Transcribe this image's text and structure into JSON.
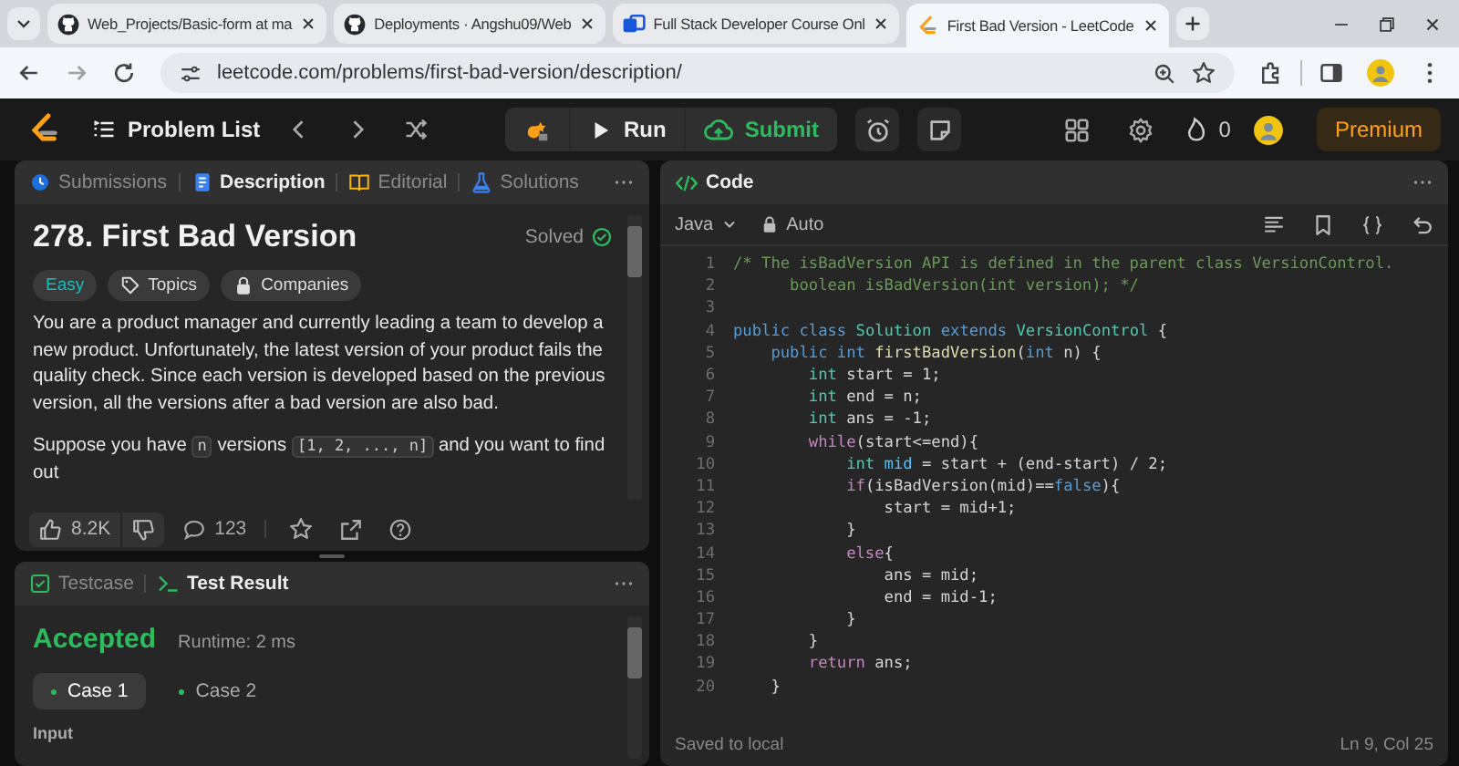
{
  "browser": {
    "tabs": [
      {
        "title": "Web_Projects/Basic-form at ma",
        "kind": "github",
        "selected": false
      },
      {
        "title": "Deployments · Angshu09/Web",
        "kind": "github",
        "selected": false
      },
      {
        "title": "Full Stack Developer Course Onl",
        "kind": "course",
        "selected": false
      },
      {
        "title": "First Bad Version - LeetCode",
        "kind": "leetcode",
        "selected": true
      }
    ],
    "url": "leetcode.com/problems/first-bad-version/description/"
  },
  "nav": {
    "problem_list": "Problem List",
    "run": "Run",
    "submit": "Submit",
    "streak": "0",
    "premium": "Premium"
  },
  "description_panel": {
    "tabs": [
      {
        "label": "Submissions",
        "selected": false
      },
      {
        "label": "Description",
        "selected": true
      },
      {
        "label": "Editorial",
        "selected": false
      },
      {
        "label": "Solutions",
        "selected": false
      }
    ],
    "title": "278. First Bad Version",
    "status": "Solved",
    "difficulty": "Easy",
    "tags": [
      "Topics",
      "Companies"
    ],
    "paragraphs": [
      "You are a product manager and currently leading a team to develop a new product. Unfortunately, the latest version of your product fails the quality check. Since each version is developed based on the previous version, all the versions after a bad version are also bad."
    ],
    "suppose": {
      "before": "Suppose you have",
      "code1": "n",
      "middle": "versions",
      "code2": "[1, 2, ..., n]",
      "after": "and you want to find out"
    },
    "likes": "8.2K",
    "comments": "123"
  },
  "result_panel": {
    "tabs": [
      {
        "label": "Testcase",
        "selected": false
      },
      {
        "label": "Test Result",
        "selected": true
      }
    ],
    "verdict": "Accepted",
    "runtime": "Runtime: 2 ms",
    "cases": [
      {
        "label": "Case 1",
        "selected": true
      },
      {
        "label": "Case 2",
        "selected": false
      }
    ],
    "input_label": "Input"
  },
  "code_panel": {
    "title": "Code",
    "language": "Java",
    "mode": "Auto",
    "footer_left": "Saved to local",
    "footer_right": "Ln 9, Col 25",
    "lines": [
      {
        "n": "1",
        "tokens": [
          {
            "text": "/* The isBadVersion API is defined in the parent class VersionControl.",
            "kind": "comment"
          }
        ]
      },
      {
        "n": "2",
        "tokens": [
          {
            "text": "      boolean isBadVersion(int version); */",
            "kind": "comment"
          }
        ]
      },
      {
        "n": "3"
      },
      {
        "n": "4",
        "tokens": [
          {
            "text": "public class ",
            "kind": "kw"
          },
          {
            "text": "Solution ",
            "kind": "type"
          },
          {
            "text": "extends ",
            "kind": "kw"
          },
          {
            "text": "VersionControl",
            "kind": "type"
          },
          {
            "text": " {",
            "kind": "plain"
          }
        ]
      },
      {
        "n": "5",
        "tokens": [
          {
            "text": "    public int ",
            "kind": "kw"
          },
          {
            "text": "firstBadVersion",
            "kind": "fn"
          },
          {
            "text": "(",
            "kind": "plain"
          },
          {
            "text": "int ",
            "kind": "kw"
          },
          {
            "text": "n) {",
            "kind": "plain"
          }
        ]
      },
      {
        "n": "6",
        "tokens": [
          {
            "text": "        int ",
            "kind": "type"
          },
          {
            "text": "start = 1;",
            "kind": "plain"
          }
        ]
      },
      {
        "n": "7",
        "tokens": [
          {
            "text": "        int ",
            "kind": "type"
          },
          {
            "text": "end = n;",
            "kind": "plain"
          }
        ]
      },
      {
        "n": "8",
        "tokens": [
          {
            "text": "        int ",
            "kind": "type"
          },
          {
            "text": "ans = -1;",
            "kind": "plain"
          }
        ]
      },
      {
        "n": "9",
        "tokens": [
          {
            "text": "        while",
            "kind": "ctrl"
          },
          {
            "text": "(start<=end){",
            "kind": "plain"
          }
        ]
      },
      {
        "n": "10",
        "tokens": [
          {
            "text": "            int ",
            "kind": "type"
          },
          {
            "text": "mid",
            "kind": "var"
          },
          {
            "text": " = start + (end-start) / 2;",
            "kind": "plain"
          }
        ]
      },
      {
        "n": "11",
        "tokens": [
          {
            "text": "            if",
            "kind": "ctrl"
          },
          {
            "text": "(isBadVersion(mid)==",
            "kind": "plain"
          },
          {
            "text": "false",
            "kind": "kw"
          },
          {
            "text": "){",
            "kind": "plain"
          }
        ]
      },
      {
        "n": "12",
        "tokens": [
          {
            "text": "                start = mid+1;",
            "kind": "plain"
          }
        ]
      },
      {
        "n": "13",
        "tokens": [
          {
            "text": "            }",
            "kind": "plain"
          }
        ]
      },
      {
        "n": "14",
        "tokens": [
          {
            "text": "            else",
            "kind": "ctrl"
          },
          {
            "text": "{",
            "kind": "plain"
          }
        ]
      },
      {
        "n": "15",
        "tokens": [
          {
            "text": "                ans = mid;",
            "kind": "plain"
          }
        ]
      },
      {
        "n": "16",
        "tokens": [
          {
            "text": "                end = mid-1;",
            "kind": "plain"
          }
        ]
      },
      {
        "n": "17",
        "tokens": [
          {
            "text": "            }",
            "kind": "plain"
          }
        ]
      },
      {
        "n": "18",
        "tokens": [
          {
            "text": "        }",
            "kind": "plain"
          }
        ]
      },
      {
        "n": "19",
        "tokens": [
          {
            "text": "        return ",
            "kind": "ctrl"
          },
          {
            "text": "ans;",
            "kind": "plain"
          }
        ]
      },
      {
        "n": "20",
        "tokens": [
          {
            "text": "    }",
            "kind": "plain"
          }
        ]
      }
    ]
  }
}
